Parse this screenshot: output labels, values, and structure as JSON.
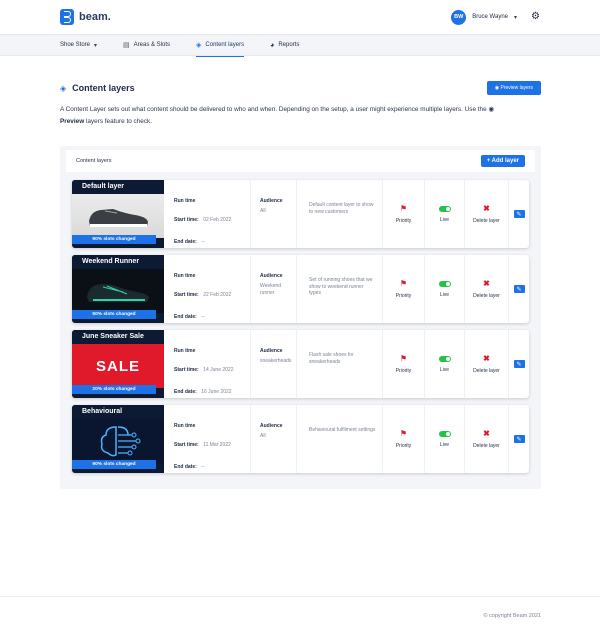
{
  "app": {
    "logo_text": "beam.",
    "logo_icon": "beam-logo-icon",
    "colors": {
      "accent": "#1d72e8",
      "danger": "#e0192b",
      "live": "#24c14b",
      "dark": "#0d1a33"
    }
  },
  "user": {
    "initials": "BW",
    "name": "Bruce Wayne"
  },
  "nav": {
    "store": "Shoe Store",
    "items": [
      {
        "label": "Areas & Slots",
        "icon": "grid-icon"
      },
      {
        "label": "Content layers",
        "icon": "layers-icon",
        "active": true
      },
      {
        "label": "Reports",
        "icon": "pie-chart-icon"
      }
    ]
  },
  "page": {
    "title": "Content layers",
    "preview_button": "Preview layers",
    "description_1": "A Content Layer sets out what content should be delivered to who and when.  Depending on the setup, a user might experience multiple layers. Use the",
    "description_bold": "Preview",
    "description_2": "layers feature to check."
  },
  "panel": {
    "title": "Content layers",
    "add_button": "Add layer"
  },
  "labels": {
    "run_time": "Run time",
    "start_time": "Start time:",
    "end_date": "End date:",
    "audience": "Audience",
    "priority": "Priority",
    "live": "Live",
    "delete": "Delete layer"
  },
  "layers": [
    {
      "name": "Default layer",
      "badge": "90% slots changed",
      "start": "02 Feb 2022",
      "end": "--",
      "audience": "All",
      "description": "Default content layer to show to new customers",
      "live": true
    },
    {
      "name": "Weekend Runner",
      "badge": "50% slots changed",
      "start": "22 Feb 2022",
      "end": "--",
      "audience": "Weekend runner",
      "description": "Set of running shoes that we show to weekend runner types",
      "live": true
    },
    {
      "name": "June Sneaker Sale",
      "badge": "20% slots changed",
      "banner_text": "SALE",
      "start": "14 June 2022",
      "end": "16 June 2022",
      "audience": "sneakerheads",
      "description": "Flash sale shoes for sneakerheads",
      "live": true
    },
    {
      "name": "Behavioural",
      "badge": "90% slots changed",
      "start": "11 Mar 2022",
      "end": "--",
      "audience": "All",
      "description": "Behavioural fulfilment settings",
      "live": true
    }
  ],
  "footer": {
    "copyright": "© copyright Beam 2021"
  }
}
